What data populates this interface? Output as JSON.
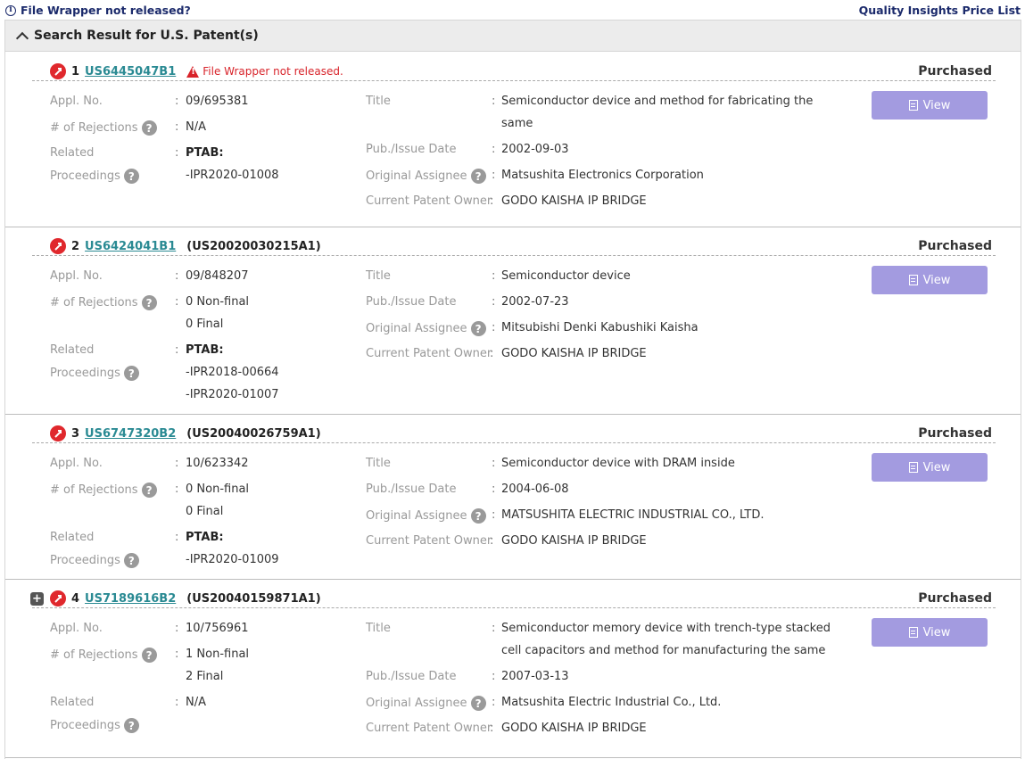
{
  "topbar": {
    "file_wrapper_link": "File Wrapper not released?",
    "price_list_link": "Quality Insights Price List"
  },
  "panel": {
    "title": "Search Result for U.S. Patent(s)"
  },
  "labels": {
    "appl_no": "Appl. No.",
    "rejections": "# of Rejections",
    "related": "Related",
    "proceedings": "Proceedings",
    "title": "Title",
    "pub_date": "Pub./Issue Date",
    "orig_assignee": "Original Assignee",
    "current_owner": "Current Patent Owner",
    "colon": ":",
    "ptab": "PTAB:",
    "view": "View",
    "purchased": "Purchased",
    "help": "?"
  },
  "records": [
    {
      "rank": "1",
      "patent": "US6445047B1",
      "warning": "File Wrapper not released.",
      "appl_no": "09/695381",
      "rejections": [
        "N/A"
      ],
      "ptab": [
        "-IPR2020-01008"
      ],
      "title": [
        "Semiconductor device and method for fabricating the",
        "same"
      ],
      "pub_date": "2002-09-03",
      "orig_assignee": "Matsushita Electronics Corporation",
      "current_owner": "GODO KAISHA IP BRIDGE"
    },
    {
      "rank": "2",
      "patent": "US6424041B1",
      "pub_no": "(US20020030215A1)",
      "appl_no": "09/848207",
      "rejections": [
        "0 Non-final",
        "0 Final"
      ],
      "ptab": [
        "-IPR2018-00664",
        "-IPR2020-01007"
      ],
      "title": [
        "Semiconductor device"
      ],
      "pub_date": "2002-07-23",
      "orig_assignee": "Mitsubishi Denki Kabushiki Kaisha",
      "current_owner": "GODO KAISHA IP BRIDGE"
    },
    {
      "rank": "3",
      "patent": "US6747320B2",
      "pub_no": "(US20040026759A1)",
      "appl_no": "10/623342",
      "rejections": [
        "0 Non-final",
        "0 Final"
      ],
      "ptab": [
        "-IPR2020-01009"
      ],
      "title": [
        "Semiconductor device with DRAM inside"
      ],
      "pub_date": "2004-06-08",
      "orig_assignee": "MATSUSHITA ELECTRIC INDUSTRIAL CO., LTD.",
      "current_owner": "GODO KAISHA IP BRIDGE"
    },
    {
      "rank": "4",
      "patent": "US7189616B2",
      "pub_no": "(US20040159871A1)",
      "appl_no": "10/756961",
      "rejections": [
        "1 Non-final",
        "2 Final"
      ],
      "related_value": "N/A",
      "title": [
        "Semiconductor memory device with trench-type stacked",
        "cell capacitors and method for manufacturing the same"
      ],
      "pub_date": "2007-03-13",
      "orig_assignee": "Matsushita Electric Industrial Co., Ltd.",
      "current_owner": "GODO KAISHA IP BRIDGE"
    }
  ]
}
